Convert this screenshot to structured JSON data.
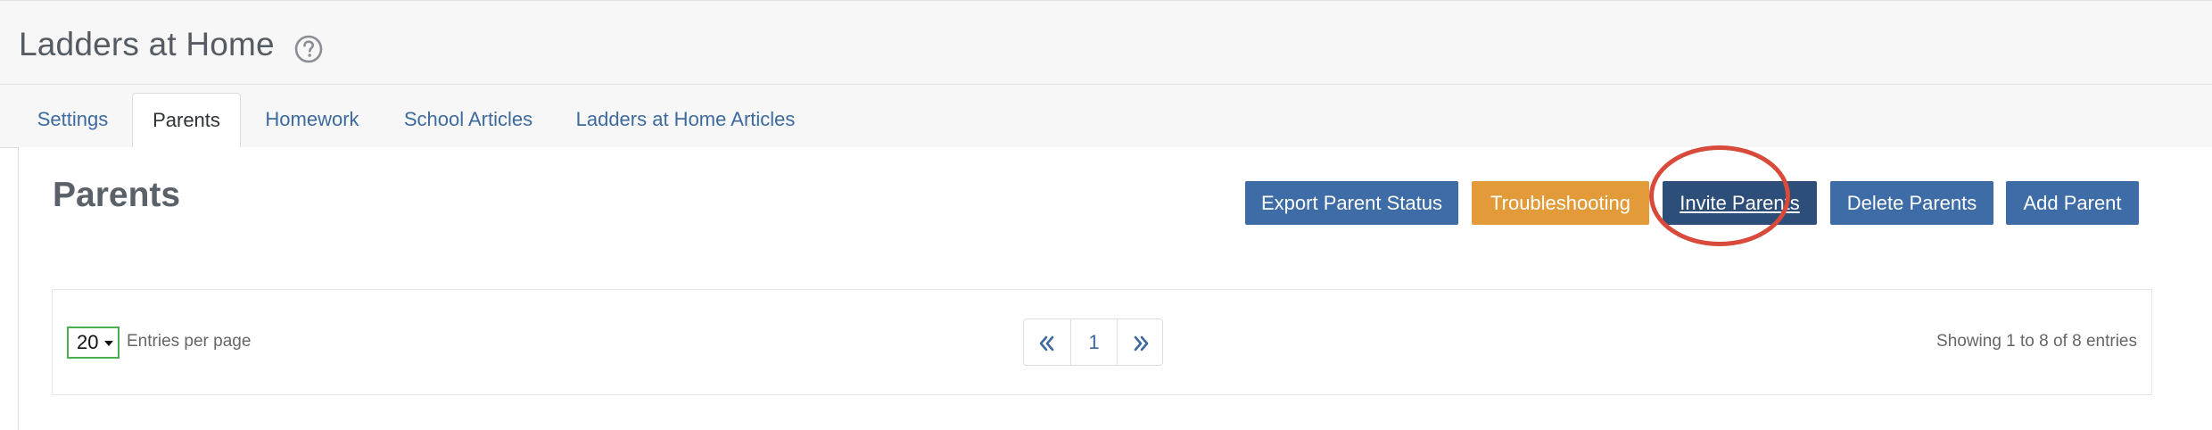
{
  "header": {
    "title": "Ladders at Home",
    "help_icon": "question-circle-icon"
  },
  "tabs": [
    {
      "label": "Settings",
      "active": false
    },
    {
      "label": "Parents",
      "active": true
    },
    {
      "label": "Homework",
      "active": false
    },
    {
      "label": "School Articles",
      "active": false
    },
    {
      "label": "Ladders at Home Articles",
      "active": false
    }
  ],
  "panel": {
    "title": "Parents",
    "buttons": {
      "export": "Export Parent Status",
      "troubleshooting": "Troubleshooting",
      "invite": "Invite Parents",
      "delete": "Delete Parents",
      "add": "Add Parent"
    }
  },
  "table_controls": {
    "per_page_value": "20",
    "per_page_label": "Entries per page",
    "pagination": {
      "prev_icon": "double-chevron-left-icon",
      "current_page": "1",
      "next_icon": "double-chevron-right-icon"
    },
    "showing_text": "Showing 1 to 8 of 8 entries"
  },
  "colors": {
    "primary": "#3e6ca6",
    "warning": "#e39b39",
    "highlight_ring": "#d84a3a",
    "select_border": "#4caf50"
  }
}
